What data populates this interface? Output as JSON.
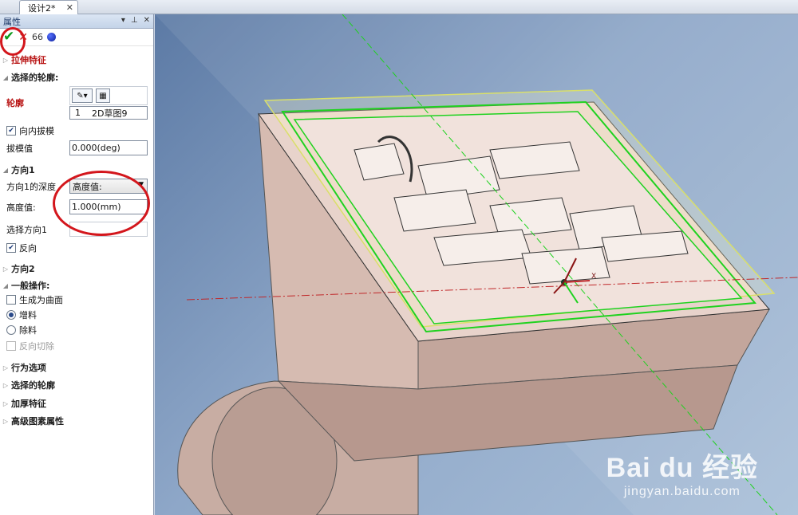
{
  "tabs": [
    {
      "label": "设计2*",
      "close": "✕"
    }
  ],
  "panel": {
    "title": "属性",
    "header_buttons": [
      "▾",
      "⊥",
      "✕"
    ],
    "toolbar": {
      "ok": "✔",
      "cancel": "✕",
      "preview": "66",
      "icons": [
        "check-icon",
        "close-icon",
        "preview-glasses-icon",
        "blue-dot-icon"
      ]
    },
    "feature_title": "拉伸特征",
    "sections": {
      "profile": {
        "title": "选择的轮廓:",
        "label": "轮廓",
        "list_item_index": "1",
        "list_item_name": "2D草图9"
      },
      "draft": {
        "checkbox_label": "向内拔模",
        "checked": true,
        "value_label": "拔模值",
        "value": "0.000(deg)"
      },
      "direction1": {
        "title": "方向1",
        "depth_label": "方向1的深度",
        "depth_option": "高度值:",
        "height_label": "高度值:",
        "height_value": "1.000(mm)",
        "select_label": "选择方向1",
        "reverse_label": "反向",
        "reverse_checked": true
      },
      "direction2": {
        "title": "方向2"
      },
      "general": {
        "title": "一般操作:",
        "surface_label": "生成为曲面",
        "add_label": "增料",
        "add_selected": true,
        "remove_label": "除料",
        "reverse_cut_label": "反向切除"
      },
      "collapsed": [
        "行为选项",
        "选择的轮廓",
        "加厚特征",
        "高级图素属性"
      ]
    }
  },
  "viewport": {
    "axis_label": "X",
    "model": "3D stamp extrusion with Chinese characters"
  },
  "watermark": {
    "main": "Bai du 经验",
    "sub": "jingyan.baidu.com"
  },
  "colors": {
    "accent_green": "#1fd21f",
    "annotation_red": "#d3161c",
    "model_face": "#e9d6cf",
    "model_side": "#d2b7ad"
  }
}
